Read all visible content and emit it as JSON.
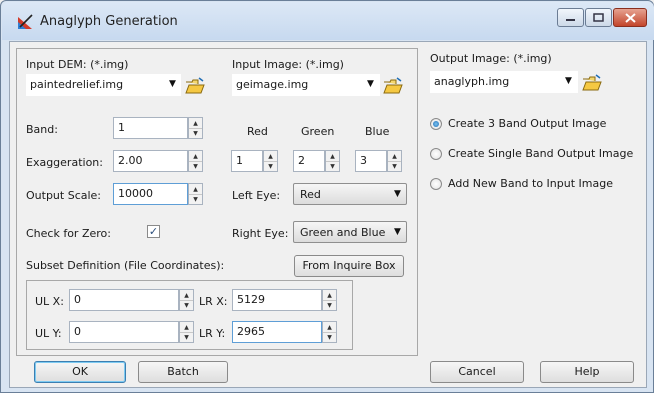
{
  "window": {
    "title": "Anaglyph Generation"
  },
  "input_dem": {
    "label": "Input DEM: (*.img)",
    "value": "paintedrelief.img"
  },
  "input_image": {
    "label": "Input Image: (*.img)",
    "value": "geimage.img"
  },
  "output_image": {
    "label": "Output Image: (*.img)",
    "value": "anaglyph.img"
  },
  "band": {
    "label": "Band:",
    "value": "1"
  },
  "rgb": {
    "red_label": "Red",
    "green_label": "Green",
    "blue_label": "Blue",
    "red_value": "1",
    "green_value": "2",
    "blue_value": "3"
  },
  "exaggeration": {
    "label": "Exaggeration:",
    "value": "2.00"
  },
  "output_scale": {
    "label": "Output Scale:",
    "value": "10000"
  },
  "left_eye": {
    "label": "Left Eye:",
    "value": "Red"
  },
  "right_eye": {
    "label": "Right Eye:",
    "value": "Green and Blue"
  },
  "check_zero": {
    "label": "Check for Zero:",
    "checked": true,
    "mark": "✓"
  },
  "subset": {
    "label": "Subset Definition (File Coordinates):",
    "from_inquire": "From Inquire Box",
    "ulx_label": "UL X:",
    "ulx_value": "0",
    "lrx_label": "LR X:",
    "lrx_value": "5129",
    "uly_label": "UL Y:",
    "uly_value": "0",
    "lry_label": "LR Y:",
    "lry_value": "2965"
  },
  "output_options": {
    "opt1": "Create 3 Band Output Image",
    "opt2": "Create Single Band Output Image",
    "opt3": "Add New Band to Input Image",
    "selected": "opt1"
  },
  "buttons": {
    "ok": "OK",
    "batch": "Batch",
    "cancel": "Cancel",
    "help": "Help"
  },
  "colors": {
    "title_bar": "#c7d9ef",
    "close_button": "#c3452b",
    "accent": "#1f6db4"
  }
}
